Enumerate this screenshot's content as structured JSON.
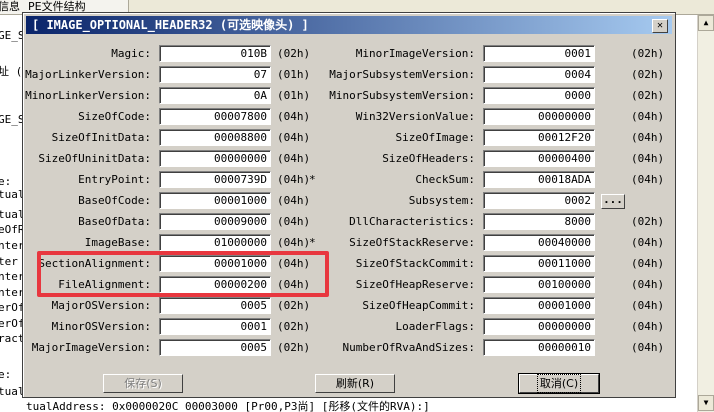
{
  "background": {
    "tabs": [
      "信息",
      "PE文件结构"
    ],
    "left_fragments": [
      "GE_S",
      "址 (F",
      "GE_S",
      "e:",
      "tual",
      "tual",
      "eOfR",
      "nter",
      "ter",
      "nter",
      "nter",
      "erOf",
      "erOf",
      "ract",
      "e:",
      "tual"
    ],
    "bottom_text": "tualAddress:       0x0000020C      00003000       [Pr00,P3尚] [彤移(文件的RVA):]"
  },
  "dialog": {
    "title": "[ IMAGE_OPTIONAL_HEADER32 (可选映像头) ]",
    "close_glyph": "✕",
    "left_fields": [
      {
        "label": "Magic:",
        "value": "010B",
        "size": "(02h)",
        "mark": ""
      },
      {
        "label": "MajorLinkerVersion:",
        "value": "07",
        "size": "(01h)",
        "mark": ""
      },
      {
        "label": "MinorLinkerVersion:",
        "value": "0A",
        "size": "(01h)",
        "mark": ""
      },
      {
        "label": "SizeOfCode:",
        "value": "00007800",
        "size": "(04h)",
        "mark": ""
      },
      {
        "label": "SizeOfInitData:",
        "value": "00008800",
        "size": "(04h)",
        "mark": ""
      },
      {
        "label": "SizeOfUninitData:",
        "value": "00000000",
        "size": "(04h)",
        "mark": ""
      },
      {
        "label": "EntryPoint:",
        "value": "0000739D",
        "size": "(04h)",
        "mark": "*"
      },
      {
        "label": "BaseOfCode:",
        "value": "00001000",
        "size": "(04h)",
        "mark": ""
      },
      {
        "label": "BaseOfData:",
        "value": "00009000",
        "size": "(04h)",
        "mark": ""
      },
      {
        "label": "ImageBase:",
        "value": "01000000",
        "size": "(04h)",
        "mark": "*"
      },
      {
        "label": "SectionAlignment:",
        "value": "00001000",
        "size": "(04h)",
        "mark": ""
      },
      {
        "label": "FileAlignment:",
        "value": "00000200",
        "size": "(04h)",
        "mark": ""
      },
      {
        "label": "MajorOSVersion:",
        "value": "0005",
        "size": "(02h)",
        "mark": ""
      },
      {
        "label": "MinorOSVersion:",
        "value": "0001",
        "size": "(02h)",
        "mark": ""
      },
      {
        "label": "MajorImageVersion:",
        "value": "0005",
        "size": "(02h)",
        "mark": ""
      }
    ],
    "right_fields": [
      {
        "label": "MinorImageVersion:",
        "value": "0001",
        "size": "(02h)"
      },
      {
        "label": "MajorSubsystemVersion:",
        "value": "0004",
        "size": "(02h)"
      },
      {
        "label": "MinorSubsystemVersion:",
        "value": "0000",
        "size": "(02h)"
      },
      {
        "label": "Win32VersionValue:",
        "value": "00000000",
        "size": "(04h)"
      },
      {
        "label": "SizeOfImage:",
        "value": "00012F20",
        "size": "(04h)"
      },
      {
        "label": "SizeOfHeaders:",
        "value": "00000400",
        "size": "(04h)"
      },
      {
        "label": "CheckSum:",
        "value": "00018ADA",
        "size": "(04h)"
      },
      {
        "label": "Subsystem:",
        "value": "0002",
        "size": ""
      },
      {
        "label": "DllCharacteristics:",
        "value": "8000",
        "size": "(02h)"
      },
      {
        "label": "SizeOfStackReserve:",
        "value": "00040000",
        "size": "(04h)"
      },
      {
        "label": "SizeOfStackCommit:",
        "value": "00011000",
        "size": "(04h)"
      },
      {
        "label": "SizeOfHeapReserve:",
        "value": "00100000",
        "size": "(04h)"
      },
      {
        "label": "SizeOfHeapCommit:",
        "value": "00001000",
        "size": "(04h)"
      },
      {
        "label": "LoaderFlags:",
        "value": "00000000",
        "size": "(04h)"
      },
      {
        "label": "NumberOfRvaAndSizes:",
        "value": "00000010",
        "size": "(04h)"
      }
    ],
    "subsystem_button": "...",
    "buttons": {
      "save": "保存(S)",
      "refresh": "刷新(R)",
      "cancel": "取消(C)"
    },
    "highlight_color": "#e8373f",
    "title_gradient": [
      "#0a246a",
      "#a6caf0"
    ]
  }
}
